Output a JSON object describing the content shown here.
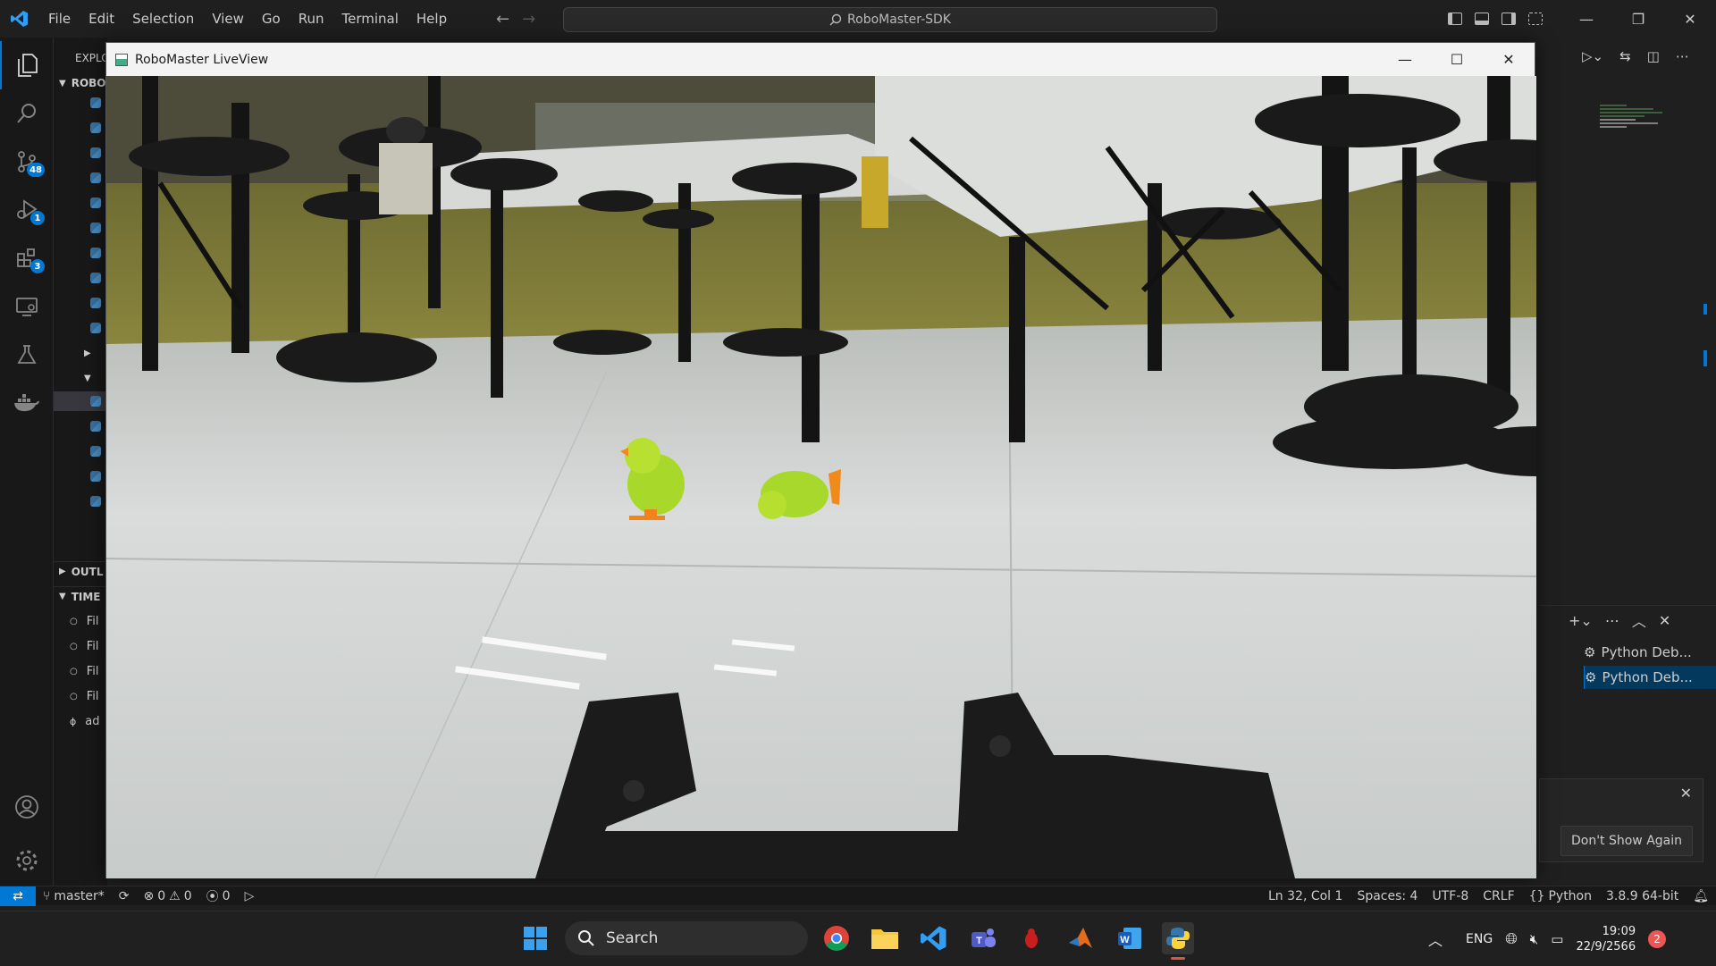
{
  "titlebar": {
    "menus": [
      "File",
      "Edit",
      "Selection",
      "View",
      "Go",
      "Run",
      "Terminal",
      "Help"
    ],
    "command_center": "RoboMaster-SDK"
  },
  "activity_bar": {
    "items": [
      {
        "icon": "files-icon",
        "badge": ""
      },
      {
        "icon": "search-icon",
        "badge": ""
      },
      {
        "icon": "source-control-icon",
        "badge": "48"
      },
      {
        "icon": "run-debug-icon",
        "badge": "1"
      },
      {
        "icon": "extensions-icon",
        "badge": "3"
      },
      {
        "icon": "remote-explorer-icon",
        "badge": ""
      },
      {
        "icon": "testing-icon",
        "badge": ""
      },
      {
        "icon": "docker-icon",
        "badge": ""
      }
    ],
    "bottom": [
      "account-icon",
      "settings-gear-icon"
    ]
  },
  "sidebar": {
    "explorer_label": "EXPLO",
    "root_label": "ROBO",
    "outline_label": "OUTL",
    "timeline_label": "TIME",
    "timeline_items": [
      "Fil",
      "Fil",
      "Fil",
      "Fil",
      "ad"
    ]
  },
  "liveview": {
    "title": "RoboMaster LiveView"
  },
  "panel": {
    "terminals": [
      "Python Deb...",
      "Python Deb..."
    ]
  },
  "notification": {
    "dont_show_again": "Don't Show Again"
  },
  "statusbar": {
    "branch": "master*",
    "errors": "0",
    "warnings": "0",
    "ports": "0",
    "position": "Ln 32, Col 1",
    "spaces": "Spaces: 4",
    "encoding": "UTF-8",
    "eol": "CRLF",
    "language": "Python",
    "interpreter": "3.8.9 64-bit"
  },
  "taskbar": {
    "search_label": "Search",
    "lang": "ENG",
    "time": "19:09",
    "date": "22/9/2566",
    "notif_count": "2"
  }
}
